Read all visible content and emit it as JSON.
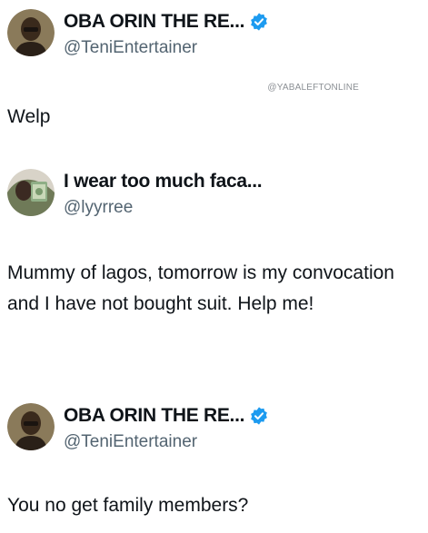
{
  "posts": [
    {
      "display_name": "OBA ORIN THE RE...",
      "handle": "@TeniEntertainer",
      "verified": true,
      "text": "Welp"
    },
    {
      "display_name": "I wear too much faca...",
      "handle": "@lyyrree",
      "verified": false,
      "text": "Mummy of lagos, tomorrow is my convocation and I have not bought suit. Help me!"
    },
    {
      "display_name": "OBA ORIN THE RE...",
      "handle": "@TeniEntertainer",
      "verified": true,
      "text": "You no get family members?"
    }
  ],
  "watermark": "@YABALEFTONLINE",
  "colors": {
    "verified_blue": "#1d9bf0",
    "handle_gray": "#536471",
    "text": "#0f1419"
  }
}
